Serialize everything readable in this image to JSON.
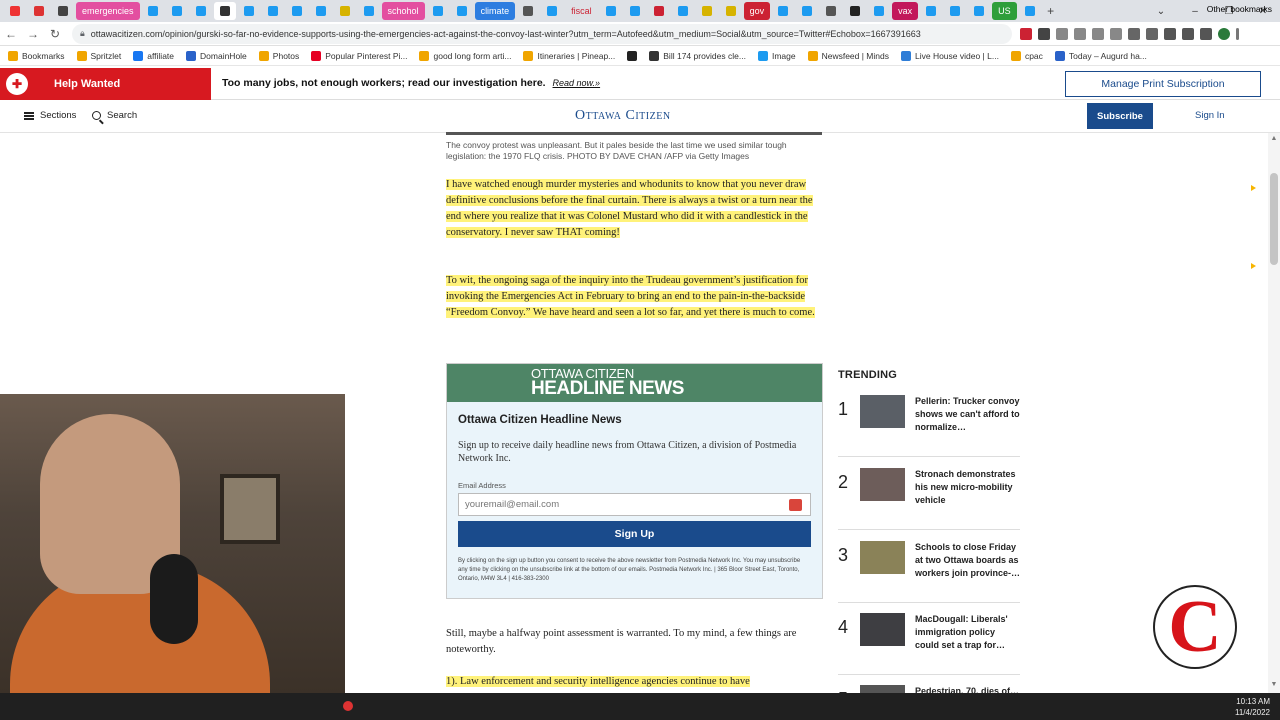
{
  "browser": {
    "tabs": [
      {
        "label": "",
        "color": "#e33"
      },
      {
        "label": "",
        "color": "#d33"
      },
      {
        "label": "",
        "color": "#444"
      },
      {
        "label": "emergencies",
        "color": "#e34fa0",
        "labeled": true
      },
      {
        "label": "",
        "color": "#1d9bf0"
      },
      {
        "label": "",
        "color": "#1d9bf0"
      },
      {
        "label": "",
        "color": "#1d9bf0"
      },
      {
        "label": "",
        "color": "#333",
        "active": true
      },
      {
        "label": "",
        "color": "#1d9bf0"
      },
      {
        "label": "",
        "color": "#1d9bf0"
      },
      {
        "label": "",
        "color": "#1d9bf0"
      },
      {
        "label": "",
        "color": "#1d9bf0"
      },
      {
        "label": "",
        "color": "#d6b300"
      },
      {
        "label": "",
        "color": "#1d9bf0"
      },
      {
        "label": "schohol",
        "color": "#e34fa0",
        "labeled": true
      },
      {
        "label": "",
        "color": "#1d9bf0"
      },
      {
        "label": "",
        "color": "#1d9bf0"
      },
      {
        "label": "climate",
        "color": "#2d7de0",
        "labeled": true
      },
      {
        "label": "",
        "color": "#555"
      },
      {
        "label": "",
        "color": "#1d9bf0"
      },
      {
        "label": "fiscal",
        "color": "#dee1e6",
        "labeled": true,
        "text_color": "#c23"
      },
      {
        "label": "",
        "color": "#1d9bf0"
      },
      {
        "label": "",
        "color": "#1d9bf0"
      },
      {
        "label": "",
        "color": "#c23"
      },
      {
        "label": "",
        "color": "#1d9bf0"
      },
      {
        "label": "",
        "color": "#d6b300"
      },
      {
        "label": "",
        "color": "#d6b300"
      },
      {
        "label": "gov",
        "color": "#c23",
        "labeled": true
      },
      {
        "label": "",
        "color": "#1d9bf0"
      },
      {
        "label": "",
        "color": "#1d9bf0"
      },
      {
        "label": "",
        "color": "#555"
      },
      {
        "label": "",
        "color": "#222"
      },
      {
        "label": "",
        "color": "#1d9bf0"
      },
      {
        "label": "vax",
        "color": "#c2185b",
        "labeled": true
      },
      {
        "label": "",
        "color": "#1d9bf0"
      },
      {
        "label": "",
        "color": "#1d9bf0"
      },
      {
        "label": "",
        "color": "#1d9bf0"
      },
      {
        "label": "US",
        "color": "#2e9e3a",
        "labeled": true
      },
      {
        "label": "",
        "color": "#1d9bf0"
      }
    ],
    "new_tab": "+",
    "window_controls": [
      "⌄",
      "–",
      "❐",
      "✕"
    ],
    "url": "ottawacitizen.com/opinion/gurski-so-far-no-evidence-supports-using-the-emergencies-act-against-the-convoy-last-winter?utm_term=Autofeed&utm_medium=Social&utm_source=Twitter#Echobox=1667391663",
    "nav": {
      "back": "←",
      "forward": "→",
      "reload": "↻"
    },
    "bookmarks": [
      {
        "label": "Bookmarks",
        "color": "#f0a500"
      },
      {
        "label": "Spritzlet",
        "color": "#f0a500"
      },
      {
        "label": "affiliate",
        "color": "#1877f2"
      },
      {
        "label": "DomainHole",
        "color": "#2a62c9"
      },
      {
        "label": "Photos",
        "color": "#f0a500"
      },
      {
        "label": "Popular Pinterest Pi...",
        "color": "#e60023"
      },
      {
        "label": "good long form arti...",
        "color": "#f0a500"
      },
      {
        "label": "Itineraries | Pineap...",
        "color": "#f0a500"
      },
      {
        "label": "",
        "color": "#222"
      },
      {
        "label": "Bill 174 provides cle...",
        "color": "#333"
      },
      {
        "label": "Image",
        "color": "#1d9bf0"
      },
      {
        "label": "Newsfeed | Minds",
        "color": "#f0a500"
      },
      {
        "label": "Live House video | L...",
        "color": "#2e7dd7"
      },
      {
        "label": "cpac",
        "color": "#f0a500"
      },
      {
        "label": "Today – Augurd ha...",
        "color": "#2a62c9"
      }
    ],
    "other_bookmarks": "Other bookmarks"
  },
  "promo": {
    "help_wanted": "Help Wanted",
    "text": "Too many jobs, not enough workers; read our investigation here.",
    "link": "Read now.»",
    "manage": "Manage Print Subscription"
  },
  "header": {
    "sections": "Sections",
    "search": "Search",
    "logo": "Ottawa Citizen",
    "subscribe": "Subscribe",
    "signin": "Sign In"
  },
  "article": {
    "caption": "The convoy protest was unpleasant. But it pales beside the last time we used similar tough legislation: the 1970 FLQ crisis. PHOTO BY DAVE CHAN /AFP via Getty Images",
    "p1": "I have watched enough murder mysteries and whodunits to know that you never draw definitive conclusions before the final curtain. There is always a twist or a turn near the end where you realize that it was Colonel Mustard who did it with a candlestick in the conservatory. I never saw THAT coming!",
    "p2": "To wit, the ongoing saga of the inquiry into the Trudeau government’s justification for invoking the Emergencies Act in February to bring an end to the pain-in-the-backside “Freedom Convoy.” We have heard and seen a lot so far, and yet there is much to come.",
    "p3": "Still, maybe a halfway point assessment is warranted. To my mind, a few things are noteworthy.",
    "p4": "1). Law enforcement and security intelligence agencies continue to have"
  },
  "newsletter": {
    "brand_top": "OTTAWA CITIZEN",
    "brand_bottom": "HEADLINE NEWS",
    "title": "Ottawa Citizen Headline News",
    "desc": "Sign up to receive daily headline news from Ottawa Citizen, a division of Postmedia Network Inc.",
    "email_label": "Email Address",
    "email_placeholder": "youremail@email.com",
    "button": "Sign Up",
    "legal": "By clicking on the sign up button you consent to receive the above newsletter from Postmedia Network Inc. You may unsubscribe any time by clicking on the unsubscribe link at the bottom of our emails. Postmedia Network Inc. | 365 Bloor Street East, Toronto, Ontario, M4W 3L4 | 416-383-2300"
  },
  "trending": {
    "heading": "TRENDING",
    "items": [
      {
        "num": "1",
        "title": "Pellerin: Trucker convoy shows we can't afford to normalize…"
      },
      {
        "num": "2",
        "title": "Stronach demonstrates his new micro-mobility vehicle"
      },
      {
        "num": "3",
        "title": "Schools to close Friday at two Ottawa boards as workers join province-…"
      },
      {
        "num": "4",
        "title": "MacDougall: Liberals' immigration policy could set a trap for…"
      },
      {
        "num": "5",
        "title": "Pedestrian, 70, dies of…"
      }
    ]
  },
  "overlay_logo": "C",
  "taskbar": {
    "time": "10:13 AM",
    "date": "11/4/2022"
  },
  "colors": {
    "brand_blue": "#1a4b8c",
    "help_red": "#d71920",
    "highlight": "#fff27a",
    "newsletter_green": "#4e8566"
  }
}
